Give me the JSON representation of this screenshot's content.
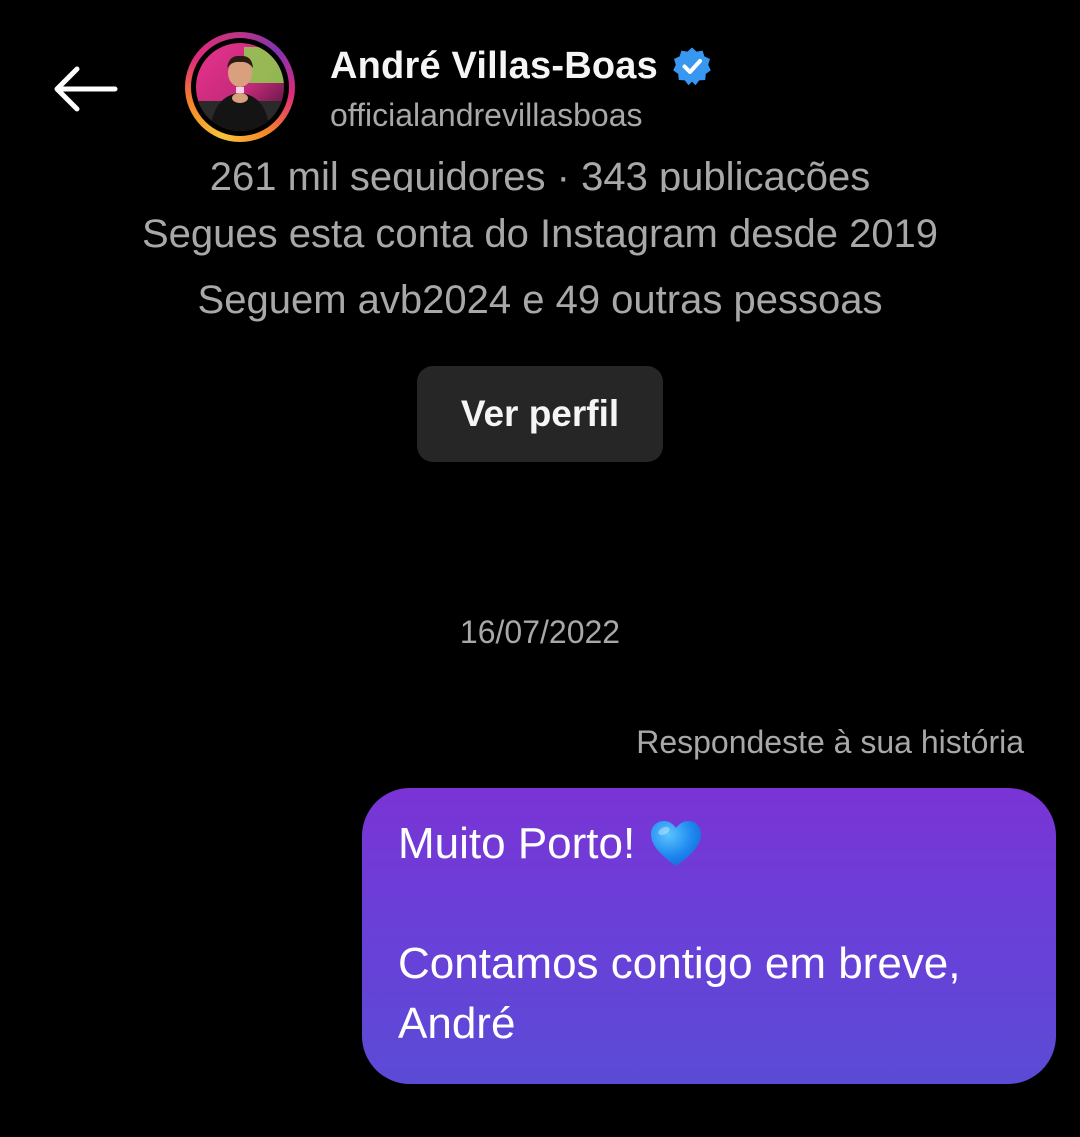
{
  "header": {
    "display_name": "André Villas-Boas",
    "username": "officialandrevillasboas",
    "verified": true,
    "icons": {
      "back": "arrow-left-icon",
      "verified": "verified-badge-icon"
    },
    "colors": {
      "verified_blue": "#3897f0",
      "story_ring": [
        "#f7c33a",
        "#f58529",
        "#dd2a7b",
        "#8134af"
      ]
    }
  },
  "profile_summary": {
    "stats": "261 mil seguidores · 343 publicações",
    "following_since": "Segues esta conta do Instagram desde 2019",
    "mutual_followers": "Seguem avb2024 e 49 outras pessoas",
    "view_profile_label": "Ver perfil"
  },
  "conversation": {
    "date": "16/07/2022",
    "reply_context": "Respondeste à sua história",
    "message": {
      "line1": "Muito Porto!",
      "emoji": "blue-heart-icon",
      "line2": "Contamos contigo em breve,",
      "line3": "André"
    },
    "colors": {
      "bubble_top": "#7a34d6",
      "bubble_bottom": "#5b4bd6"
    }
  }
}
